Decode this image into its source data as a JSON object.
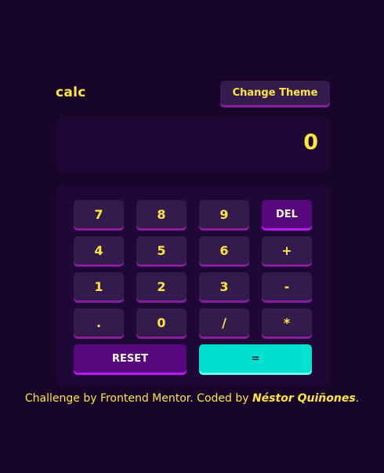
{
  "header": {
    "logo": "calc",
    "theme_button": "Change Theme"
  },
  "screen": {
    "value": "0"
  },
  "keys": {
    "k7": "7",
    "k8": "8",
    "k9": "9",
    "del": "DEL",
    "k4": "4",
    "k5": "5",
    "k6": "6",
    "plus": "+",
    "k1": "1",
    "k2": "2",
    "k3": "3",
    "minus": "-",
    "dot": ".",
    "k0": "0",
    "divide": "/",
    "multiply": "*",
    "reset": "RESET",
    "equals": "="
  },
  "attribution": {
    "prefix": "Challenge by Frontend Mentor. Coded by ",
    "author": "Néstor Quiñones",
    "suffix": "."
  },
  "colors": {
    "background": "#17062a",
    "panel": "#1e0836",
    "key": "#331c4d",
    "key_shadow": "#881c9e",
    "accent_key": "#56077c",
    "equals_key": "#00e0d1",
    "text": "#ffe53d"
  }
}
